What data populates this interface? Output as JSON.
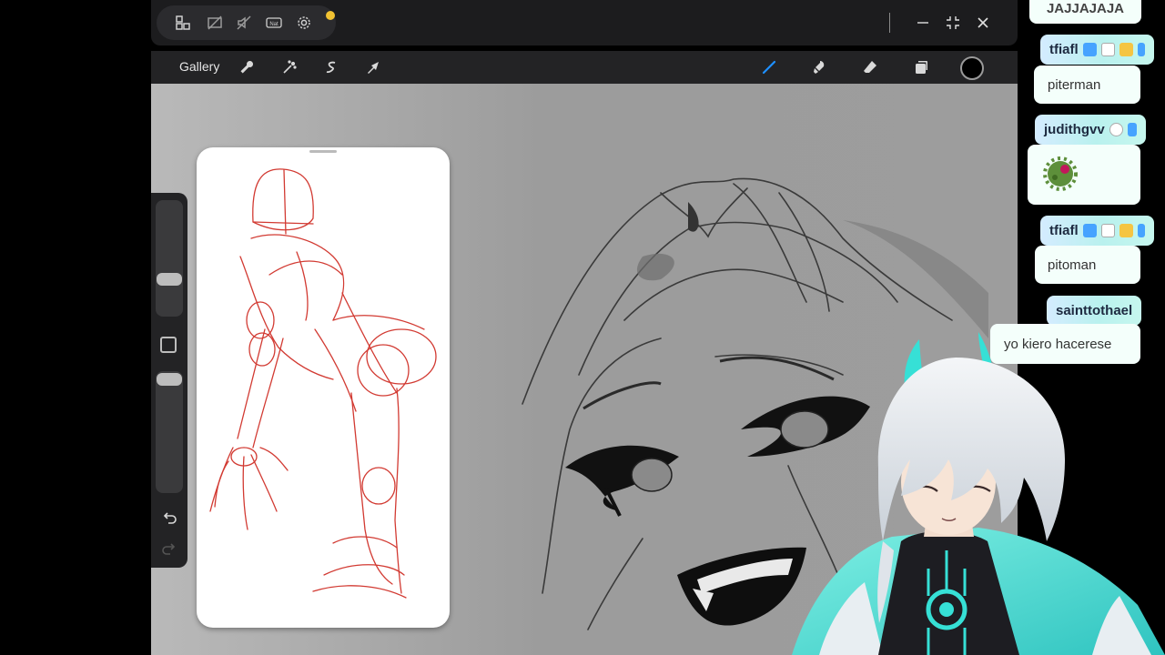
{
  "window_bar": {
    "icons": [
      "layout-icon",
      "screen-off-icon",
      "mute-icon",
      "nat-icon",
      "settings-icon"
    ],
    "nat_label": "Nat",
    "controls": [
      "minimize-icon",
      "restore-icon",
      "close-icon"
    ]
  },
  "toolbar": {
    "gallery_label": "Gallery",
    "left_tools": [
      "wrench-icon",
      "magic-wand-icon",
      "selection-icon",
      "transform-icon"
    ],
    "right_tools": [
      "brush-icon",
      "smudge-icon",
      "eraser-icon",
      "layers-icon"
    ],
    "color": "#000000",
    "active_tool_color": "#1e90ff"
  },
  "chat": {
    "items": [
      {
        "type": "message_partial",
        "text": "JAJJAJAJA"
      },
      {
        "type": "name",
        "user": "tfiafl",
        "badges": [
          "badge-1",
          "badge-2",
          "badge-3",
          "badge-4"
        ]
      },
      {
        "type": "message",
        "text": "piterman"
      },
      {
        "type": "name",
        "user": "judithgvv",
        "badges": [
          "badge-1",
          "badge-2"
        ]
      },
      {
        "type": "emote",
        "icon": "green-virus-emote"
      },
      {
        "type": "name",
        "user": "tfiafl",
        "badges": [
          "badge-1",
          "badge-2",
          "badge-3",
          "badge-4"
        ]
      },
      {
        "type": "message",
        "text": "pitoman"
      },
      {
        "type": "name",
        "user": "sainttothael",
        "badges": []
      },
      {
        "type": "message",
        "text": "yo kiero hacerese"
      }
    ]
  },
  "colors": {
    "chat_name_gradient_start": "#d4ecff",
    "chat_name_gradient_end": "#c6f7ee",
    "sketch_red": "#d23a32",
    "vtuber_accent": "#36e0d6"
  }
}
